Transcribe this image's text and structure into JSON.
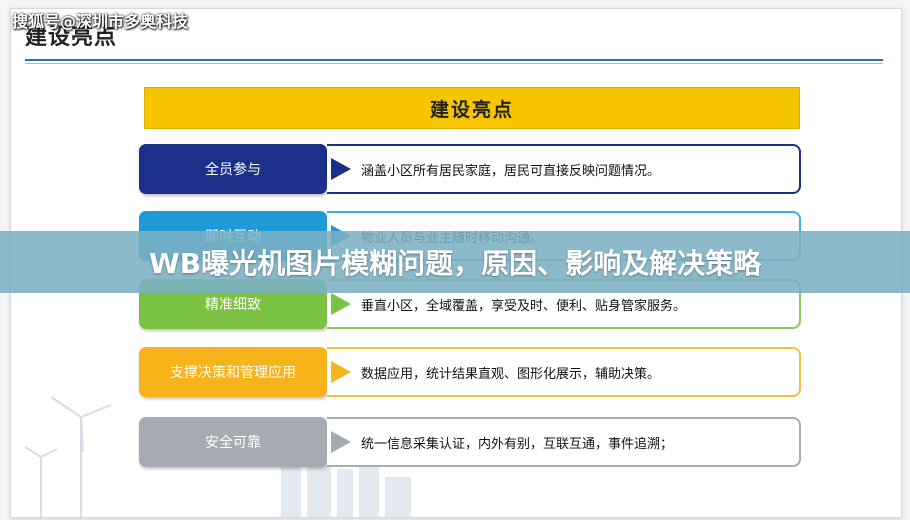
{
  "watermark": "搜狐号@深圳市多奥科技",
  "slide": {
    "title": "建设亮点",
    "banner": "建设亮点",
    "rows": [
      {
        "tag": "全员参与",
        "text": "涵盖小区所有居民家庭，居民可直接反映问题情况。",
        "color": "#1c2f8a",
        "border": "#1c2f8a"
      },
      {
        "tag": "即时互动",
        "text": "物业人员与业主随时移动沟通。",
        "color": "#1e9ad6",
        "border": "#3fb0e4"
      },
      {
        "tag": "精准细致",
        "text": "垂直小区，全域覆盖，享受及时、便利、贴身管家服务。",
        "color": "#7cc242",
        "border": "#8cc85a"
      },
      {
        "tag": "支撑决策和管理应用",
        "text": "数据应用，统计结果直观、图形化展示，辅助决策。",
        "color": "#f6b41a",
        "border": "#f3c13c"
      },
      {
        "tag": "安全可靠",
        "text": "统一信息采集认证，内外有别，互联互通，事件追溯；",
        "color": "#a6aab3",
        "border": "#a6aab3"
      }
    ]
  },
  "overlay": {
    "headline": "WB曝光机图片模糊问题，原因、影响及解决策略"
  }
}
